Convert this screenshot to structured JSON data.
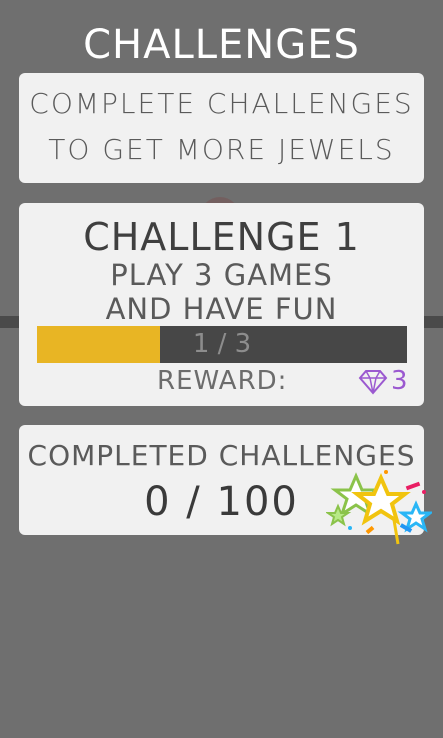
{
  "screen": {
    "title": "CHALLENGES"
  },
  "info": {
    "line1": "COMPLETE CHALLENGES",
    "line2": "TO GET MORE JEWELS"
  },
  "challenge": {
    "title": "CHALLENGE 1",
    "desc_line1": "PLAY 3 GAMES",
    "desc_line2": "AND HAVE FUN",
    "progress_text": "1 / 3",
    "progress_fraction": 0.333,
    "reward_label": "REWARD:",
    "reward_value": "3",
    "reward_icon": "diamond-icon"
  },
  "completed": {
    "label": "COMPLETED CHALLENGES",
    "value": "0 / 100",
    "badge_icon": "celebration-stars-icon"
  },
  "colors": {
    "background": "#6f6f6f",
    "card": "#f1f1f1",
    "progress": "#e8b524",
    "gem": "#9b59d0"
  }
}
